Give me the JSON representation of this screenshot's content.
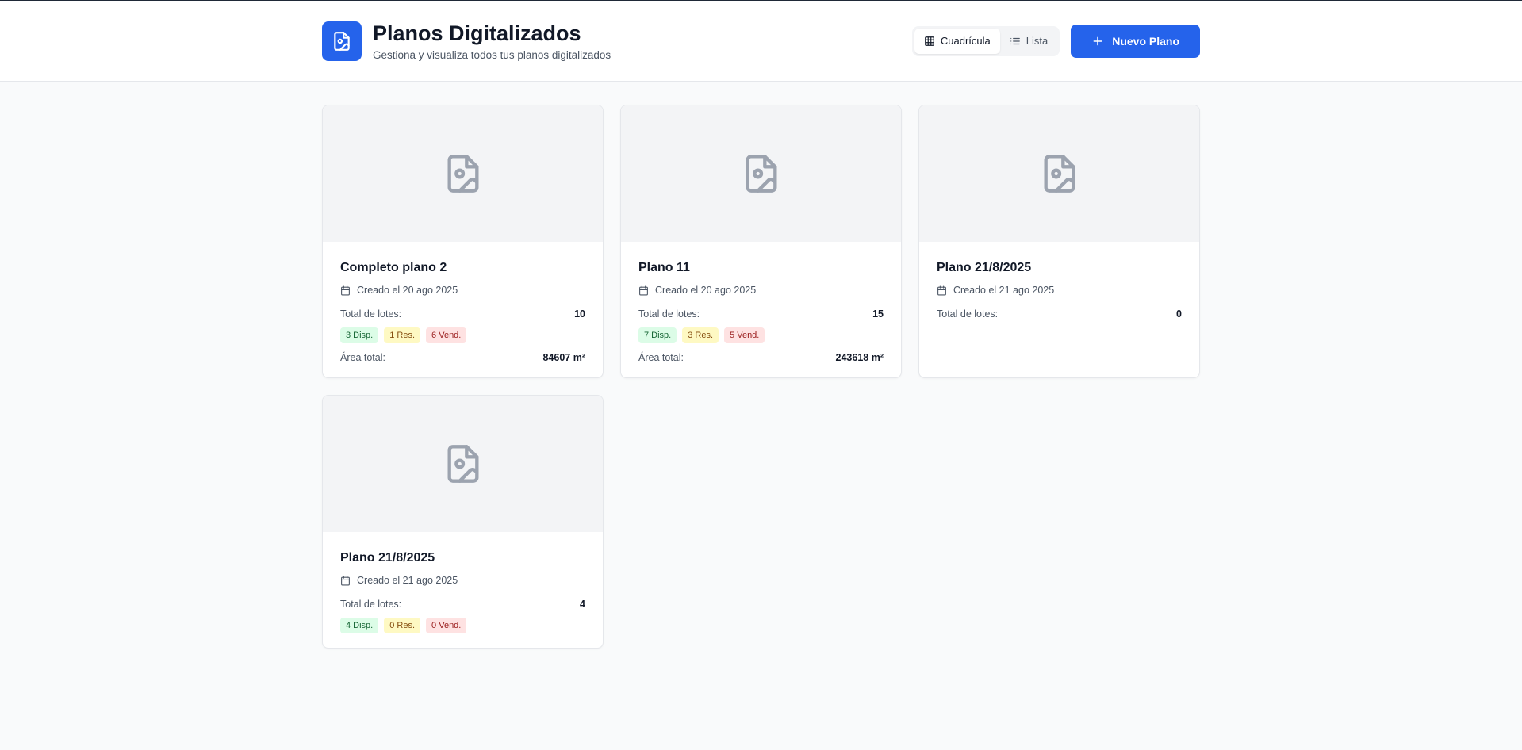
{
  "header": {
    "title": "Planos Digitalizados",
    "subtitle": "Gestiona y visualiza todos tus planos digitalizados",
    "view_grid_label": "Cuadrícula",
    "view_list_label": "Lista",
    "new_button_label": "Nuevo Plano"
  },
  "colors": {
    "accent": "#2563eb",
    "available": "#dcfce7",
    "reserved": "#fef9c3",
    "sold": "#fee2e2"
  },
  "cards": [
    {
      "title": "Completo plano 2",
      "created": "Creado el 20 ago 2025",
      "lots_label": "Total de lotes:",
      "lots_value": "10",
      "available": "3 Disp.",
      "reserved": "1 Res.",
      "sold": "6 Vend.",
      "area_label": "Área total:",
      "area_value": "84607 m²"
    },
    {
      "title": "Plano 11",
      "created": "Creado el 20 ago 2025",
      "lots_label": "Total de lotes:",
      "lots_value": "15",
      "available": "7 Disp.",
      "reserved": "3 Res.",
      "sold": "5 Vend.",
      "area_label": "Área total:",
      "area_value": "243618 m²"
    },
    {
      "title": "Plano 21/8/2025",
      "created": "Creado el 21 ago 2025",
      "lots_label": "Total de lotes:",
      "lots_value": "0"
    },
    {
      "title": "Plano 21/8/2025",
      "created": "Creado el 21 ago 2025",
      "lots_label": "Total de lotes:",
      "lots_value": "4",
      "available": "4 Disp.",
      "reserved": "0 Res.",
      "sold": "0 Vend."
    }
  ]
}
